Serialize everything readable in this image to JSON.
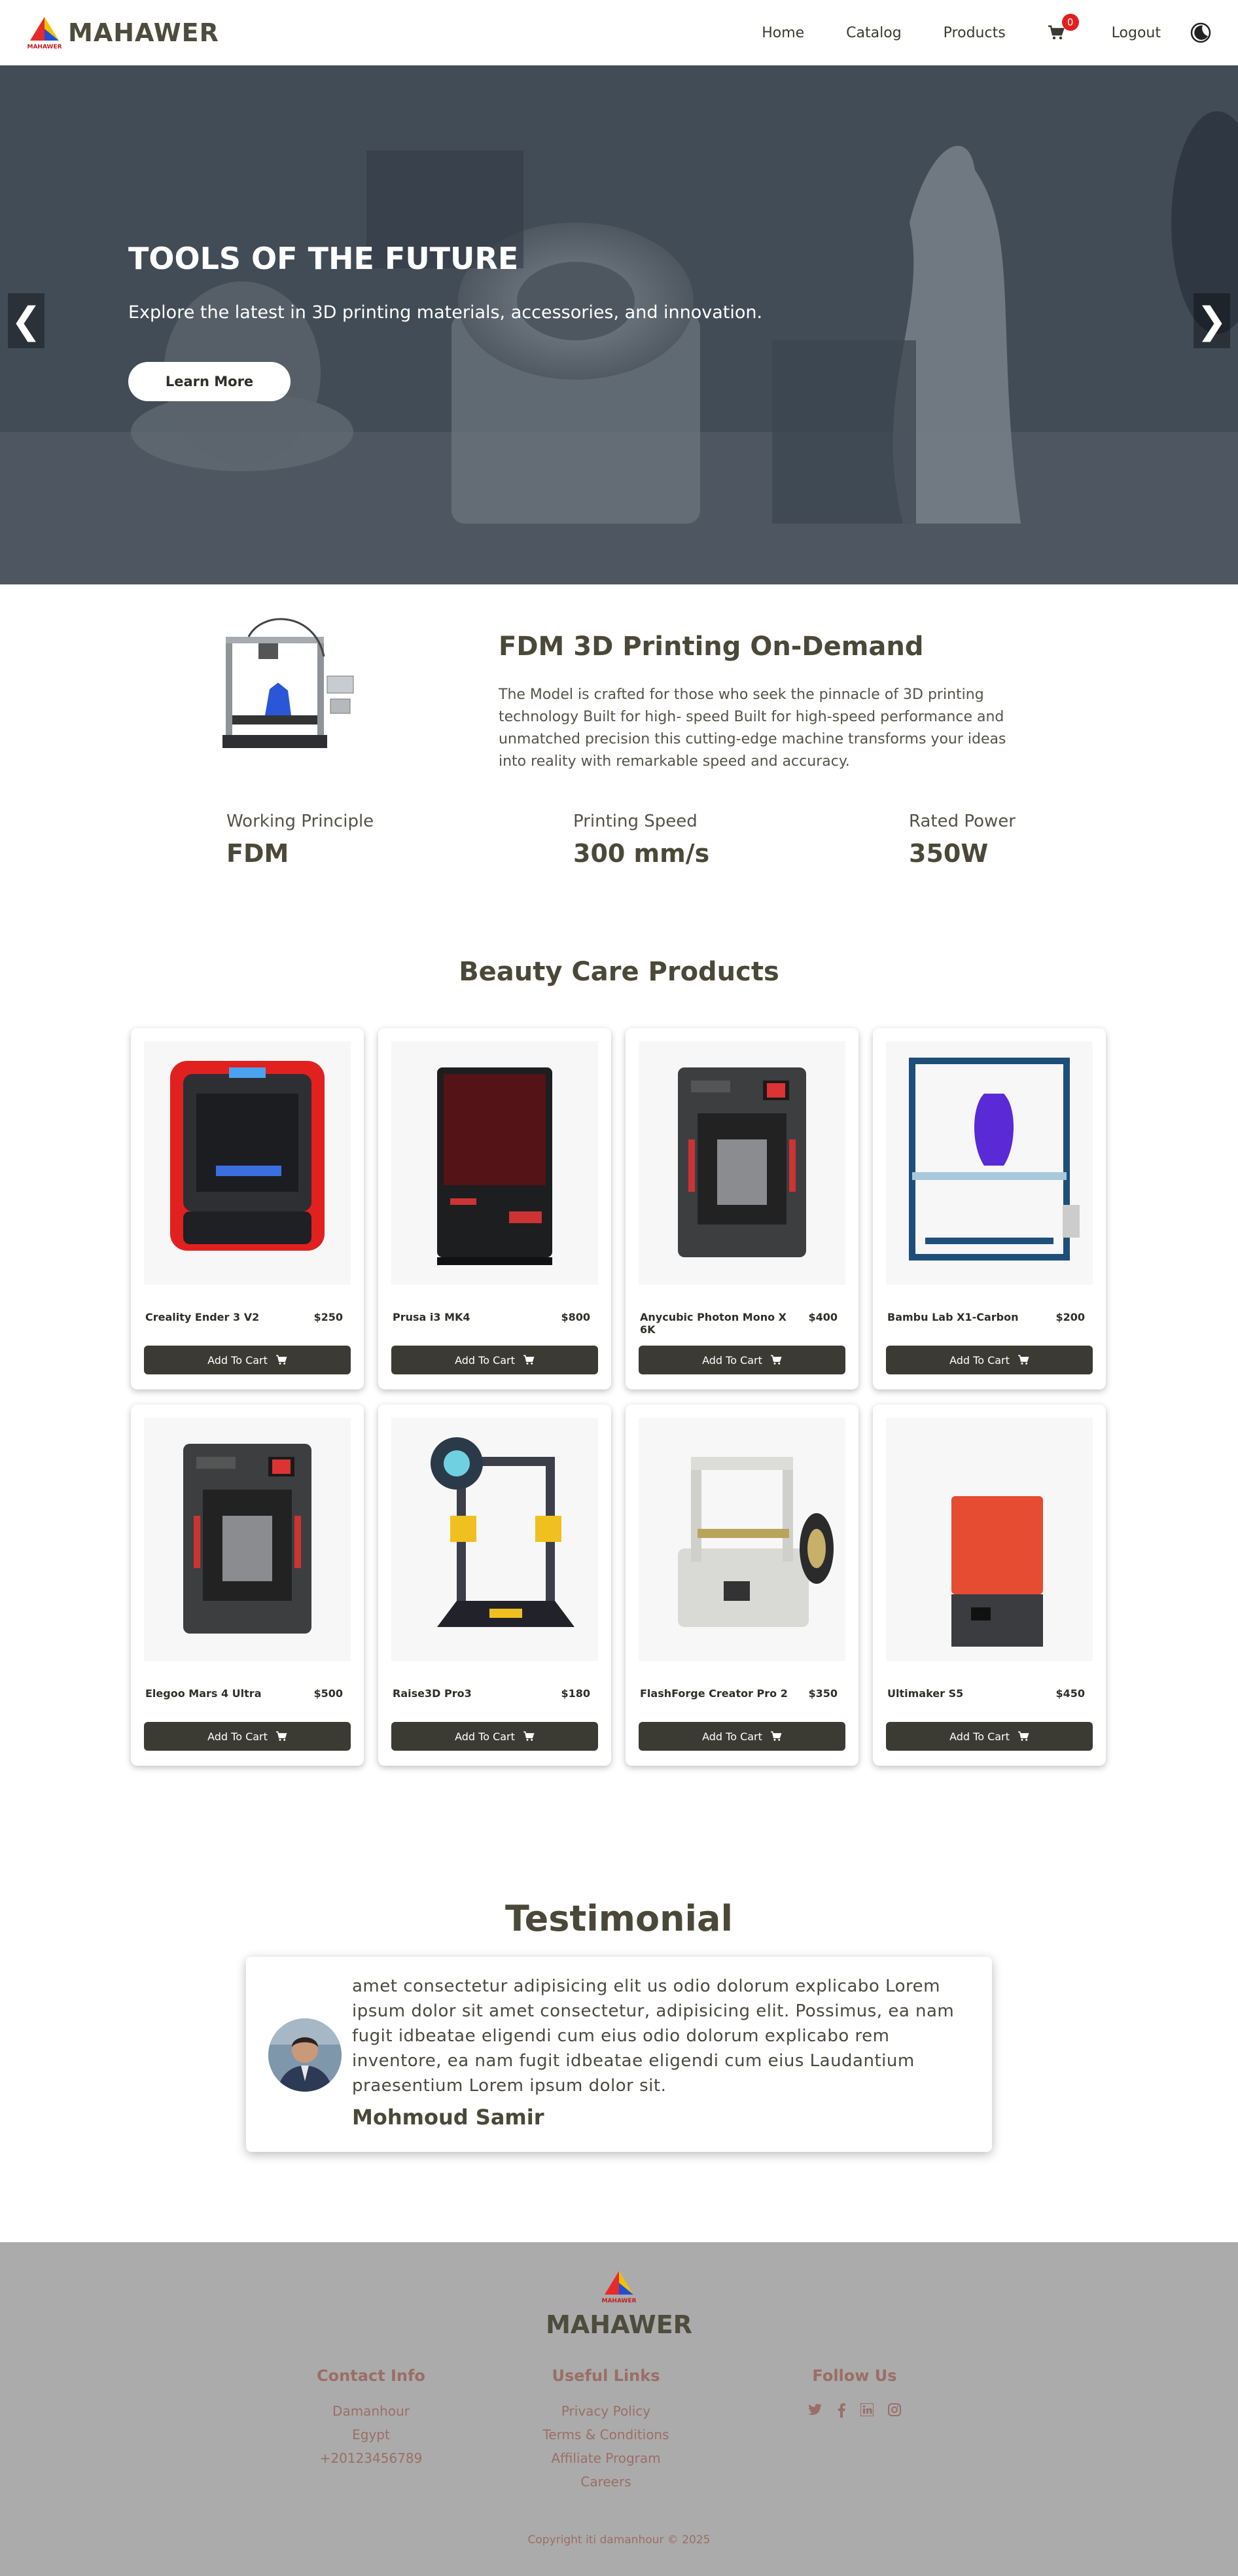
{
  "nav": {
    "brand": "MAHAWER",
    "logo_caption": "MAHAWER",
    "links": [
      "Home",
      "Catalog",
      "Products"
    ],
    "cart_count": "0",
    "logout": "Logout"
  },
  "hero": {
    "title": "TOOLS OF THE FUTURE",
    "subtitle": "Explore the latest in 3D printing materials, accessories, and innovation.",
    "button": "Learn More",
    "prev": "❮",
    "next": "❯"
  },
  "feature": {
    "title": "FDM 3D Printing On-Demand",
    "description": "The Model is crafted for those who seek the pinnacle of 3D printing technology Built for high- speed Built for high-speed performance and unmatched precision this cutting-edge machine transforms your ideas into reality with remarkable speed and accuracy.",
    "specs": [
      {
        "label": "Working Principle",
        "value": "FDM"
      },
      {
        "label": "Printing Speed",
        "value": "300 mm/s"
      },
      {
        "label": "Rated Power",
        "value": "350W"
      }
    ]
  },
  "products": {
    "title": "Beauty Care Products",
    "button_label": "Add To Cart",
    "items": [
      {
        "name": "Creality Ender 3 V2",
        "price": "$250",
        "image": "red-enclosed-printer"
      },
      {
        "name": "Prusa i3 MK4",
        "price": "$800",
        "image": "black-resin-printer"
      },
      {
        "name": "Anycubic Photon Mono X 6K",
        "price": "$400",
        "image": "gray-enclosed-printer"
      },
      {
        "name": "Bambu Lab X1-Carbon",
        "price": "$200",
        "image": "blue-frame-printer"
      },
      {
        "name": "Elegoo Mars 4 Ultra",
        "price": "$500",
        "image": "gray-enclosed-printer"
      },
      {
        "name": "Raise3D Pro3",
        "price": "$180",
        "image": "open-frame-printer"
      },
      {
        "name": "FlashForge Creator Pro 2",
        "price": "$350",
        "image": "white-printer"
      },
      {
        "name": "Ultimaker S5",
        "price": "$450",
        "image": "orange-resin-printer"
      }
    ]
  },
  "testimonial": {
    "title": "Testimonial",
    "text": "amet consectetur adipisicing elit us odio dolorum explicabo Lorem ipsum dolor sit amet consectetur, adipisicing elit. Possimus, ea nam fugit idbeatae eligendi cum eius odio dolorum explicabo rem inventore, ea nam fugit idbeatae eligendi cum eius Laudantium praesentium Lorem ipsum dolor sit.",
    "name": "Mohmoud Samir"
  },
  "footer": {
    "brand": "MAHAWER",
    "contact": {
      "title": "Contact Info",
      "items": [
        "Damanhour",
        "Egypt",
        "+20123456789"
      ]
    },
    "links": {
      "title": "Useful Links",
      "items": [
        "Privacy Policy",
        "Terms & Conditions",
        "Affiliate Program",
        "Careers"
      ]
    },
    "follow": {
      "title": "Follow Us",
      "icons": [
        "twitter-icon",
        "facebook-icon",
        "linkedin-icon",
        "instagram-icon"
      ]
    },
    "copyright": "Copyright iti damanhour © 2025"
  },
  "colors": {
    "dark_olive": "#4a4838",
    "button_dark": "#3c3b33",
    "footer_bg": "#ababab",
    "footer_text": "#9b6e66",
    "badge": "#e21f1f"
  }
}
